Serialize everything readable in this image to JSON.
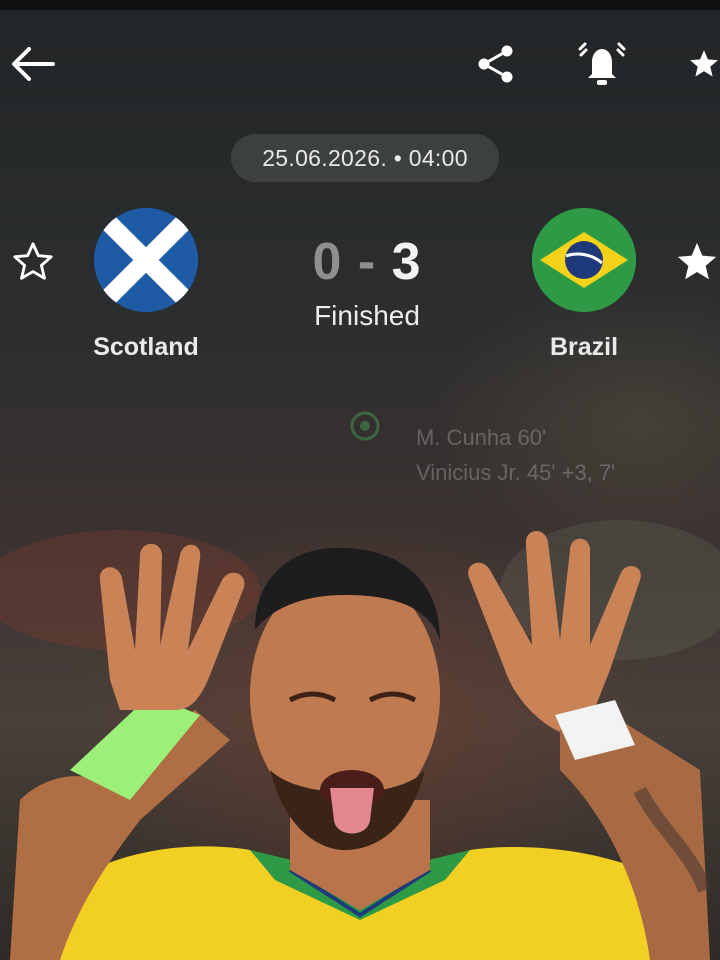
{
  "header": {
    "back_icon": "arrow-left-icon",
    "share_icon": "share-icon",
    "notify_icon": "bell-icon",
    "favorite_icon": "star-filled-icon"
  },
  "match": {
    "datetime": "25.06.2026. • 04:00",
    "home_team": {
      "name": "Scotland",
      "flag": "scotland-flag",
      "favorite": false
    },
    "away_team": {
      "name": "Brazil",
      "flag": "brazil-flag",
      "favorite": true
    },
    "score": {
      "home": "0",
      "separator": "-",
      "away": "3"
    },
    "status": "Finished",
    "goal_scorers": [
      "M. Cunha 60'",
      "Vinicius Jr. 45' +3, 7'"
    ]
  },
  "colors": {
    "scotland_blue": "#1f5aa5",
    "brazil_green": "#2e9a45",
    "brazil_yellow": "#f4d21a",
    "brazil_blue": "#1e3a7a"
  }
}
